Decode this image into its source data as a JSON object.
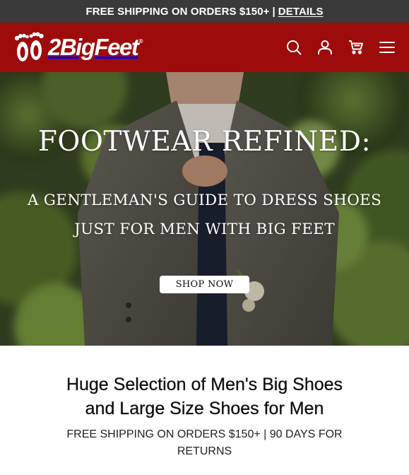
{
  "announcement": {
    "text": "FREE SHIPPING ON ORDERS $150+",
    "separator": "|",
    "link_label": "DETAILS"
  },
  "header": {
    "logo_text": "2BigFeet",
    "logo_mark": "®",
    "brand_color": "#9e0b0b",
    "icons": [
      "search-icon",
      "account-icon",
      "cart-icon",
      "menu-icon"
    ]
  },
  "hero": {
    "title": "FOOTWEAR REFINED:",
    "subtitle_line1": "A GENTLEMAN'S GUIDE TO DRESS SHOES",
    "subtitle_line2": "JUST FOR MEN WITH BIG FEET",
    "cta_label": "SHOP NOW"
  },
  "main": {
    "headline_line1": "Huge Selection of Men's Big Shoes",
    "headline_line2": "and Large Size Shoes for Men",
    "subtext": "FREE SHIPPING ON ORDERS $150+ | 90 DAYS FOR RETURNS"
  }
}
